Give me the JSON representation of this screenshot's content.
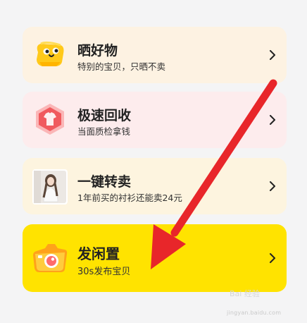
{
  "menu": {
    "items": [
      {
        "title": "晒好物",
        "subtitle": "特别的宝贝，只晒不卖",
        "icon": "cute-mascot-icon"
      },
      {
        "title": "极速回收",
        "subtitle": "当面质检拿钱",
        "icon": "recycle-tshirt-icon"
      },
      {
        "title": "一键转卖",
        "subtitle": "1年前买的衬衫还能卖24元",
        "icon": "product-photo-thumbnail"
      },
      {
        "title": "发闲置",
        "subtitle": "30s发布宝贝",
        "icon": "camera-icon"
      }
    ]
  },
  "annotation": {
    "arrow_color": "#e8262a"
  },
  "watermark": {
    "logo": "Bai 经验",
    "domain": "jingyan.baidu.com"
  }
}
